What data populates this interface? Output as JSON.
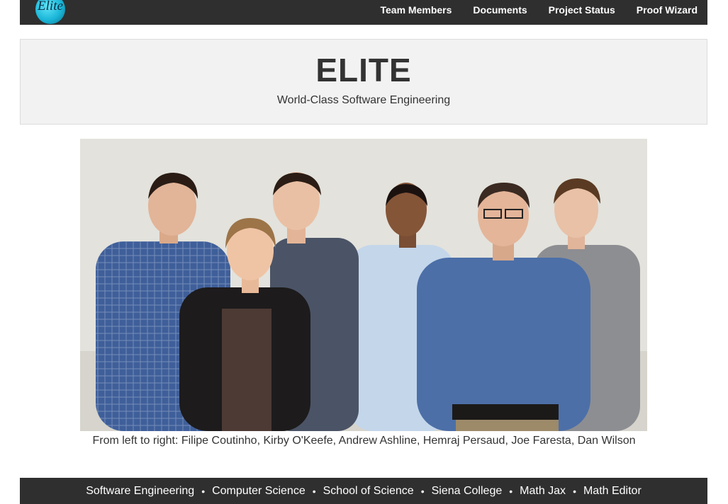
{
  "navbar": {
    "logo_text": "Elite",
    "links": [
      "Team Members",
      "Documents",
      "Project Status",
      "Proof Wizard"
    ]
  },
  "header": {
    "title": "ELITE",
    "tagline": "World-Class Software Engineering"
  },
  "photo": {
    "caption": "From left to right: Filipe Coutinho, Kirby O'Keefe, Andrew Ashline, Hemraj Persaud, Joe Faresta, Dan Wilson"
  },
  "footer": {
    "links": [
      "Software Engineering",
      "Computer Science",
      "School of Science",
      "Siena College",
      "Math Jax",
      "Math Editor"
    ],
    "separator": "•"
  },
  "colors": {
    "nav_bg": "#2f2f2f",
    "jumbotron_bg": "#f2f2f2",
    "text": "#333333",
    "logo_accent": "#1bb6d8"
  }
}
